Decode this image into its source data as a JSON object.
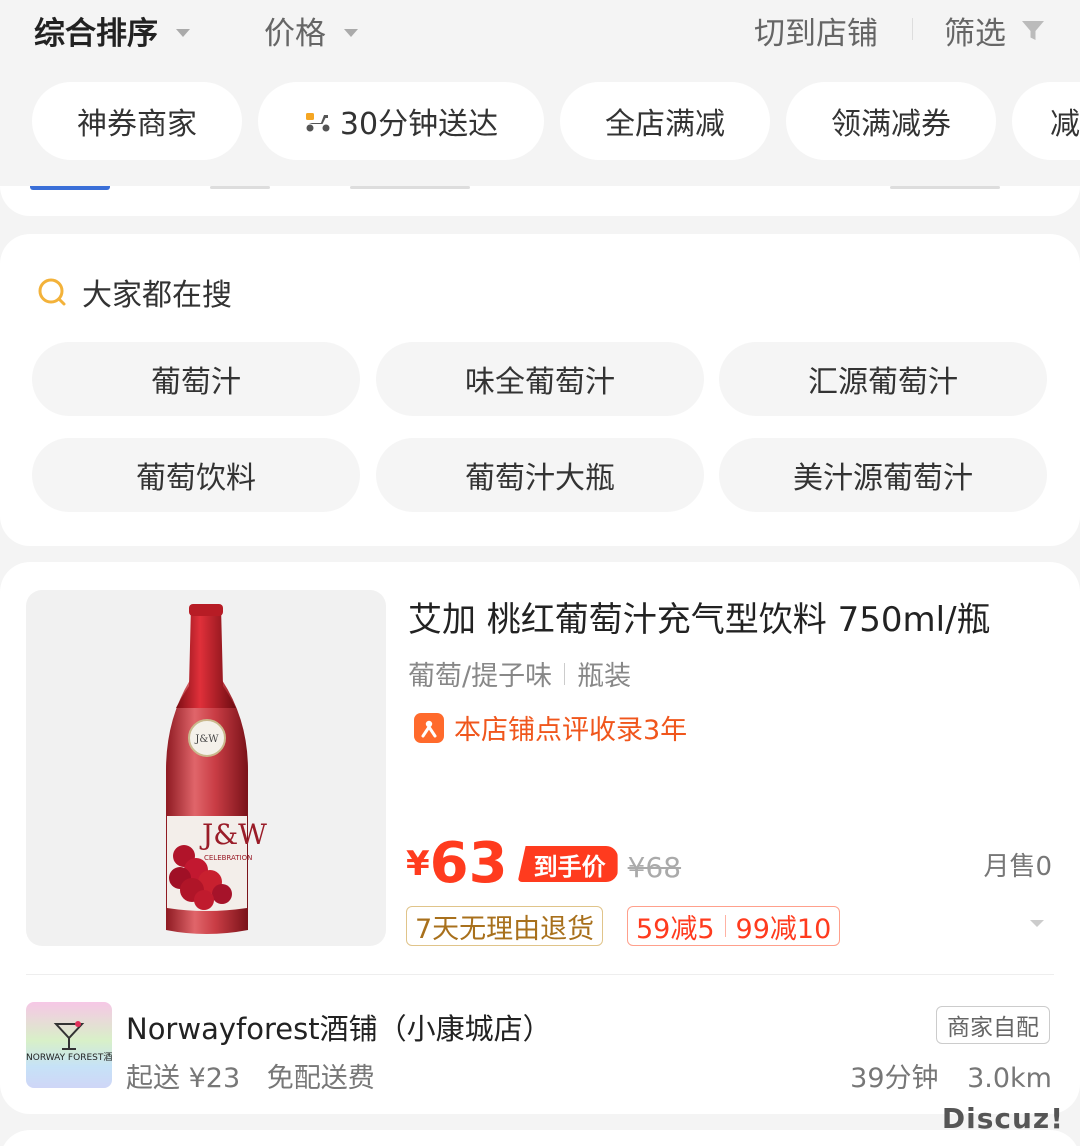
{
  "sort_bar": {
    "sort_label": "综合排序",
    "price_label": "价格",
    "switch_shop_label": "切到店铺",
    "filter_label": "筛选"
  },
  "chips": [
    {
      "label": "神券商家"
    },
    {
      "label": "30分钟送达",
      "icon": "scooter-icon"
    },
    {
      "label": "全店满减"
    },
    {
      "label": "领满减券"
    },
    {
      "label": "减"
    }
  ],
  "hot_search": {
    "title": "大家都在搜",
    "tags": [
      "葡萄汁",
      "味全葡萄汁",
      "汇源葡萄汁",
      "葡萄饮料",
      "葡萄汁大瓶",
      "美汁源葡萄汁"
    ]
  },
  "product": {
    "title": "艾加 桃红葡萄汁充气型饮料 750ml/瓶",
    "spec": [
      "葡萄/提子味",
      "瓶装"
    ],
    "review_note": "本店铺点评收录3年",
    "currency": "¥",
    "price": "63",
    "price_tag": "到手价",
    "old_price": "¥68",
    "monthly_sales": "月售0",
    "return_badge": "7天无理由退货",
    "discounts": [
      "59减5",
      "99减10"
    ],
    "bottle_label": "J&W",
    "bottle_sublabel": "CELEBRATION"
  },
  "shop": {
    "logo_text": "NORWAY FOREST酒铺",
    "name": "Norwayforest酒铺（小康城店）",
    "min_order": "起送 ¥23",
    "delivery_fee": "免配送费",
    "delivery_type": "商家自配",
    "eta": "39分钟",
    "distance": "3.0km"
  },
  "watermark": "Discuz!",
  "colors": {
    "accent_red": "#ff3b1e",
    "review_orange": "#f0561c",
    "search_icon": "#f3b23a",
    "background": "#f4f4f4"
  }
}
